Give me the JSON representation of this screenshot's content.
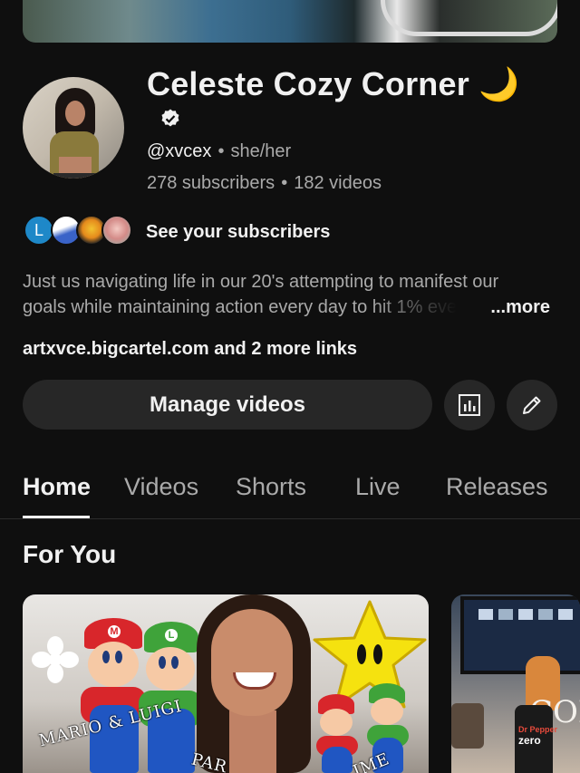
{
  "channel": {
    "name": "Celeste Cozy Corner",
    "name_emoji": "🌙",
    "handle": "@xvcex",
    "pronouns": "she/her",
    "subscribers": "278 subscribers",
    "videos": "182 videos",
    "separator": "•"
  },
  "subscribers_row": {
    "first_avatar_letter": "L",
    "label": "See your subscribers"
  },
  "description": {
    "line1": "Just us navigating life in our 20's attempting to manifest our",
    "line2": "goals while maintaining action every day to hit 1% eve",
    "more": "...more"
  },
  "links": {
    "url": "artxvce.bigcartel.com",
    "more": "and 2 more links"
  },
  "actions": {
    "manage": "Manage videos"
  },
  "tabs": [
    {
      "label": "Home",
      "active": true
    },
    {
      "label": "Videos",
      "active": false
    },
    {
      "label": "Shorts",
      "active": false
    },
    {
      "label": "Live",
      "active": false
    },
    {
      "label": "Releases",
      "active": false
    }
  ],
  "section": {
    "title": "For You"
  },
  "cards": {
    "one": {
      "overlay1": "MARIO & LUIGI",
      "overlay2": "PAR",
      "overlay3": "IME",
      "mario_cap_letter": "M",
      "luigi_cap_letter": "L"
    },
    "two": {
      "overlay": "COFF",
      "can_label": "Dr Pepper",
      "can_sub": "zero"
    }
  },
  "colors": {
    "background": "#0f0f0f",
    "surface": "#272727",
    "text_primary": "#f1f1f1",
    "text_secondary": "#aaaaaa"
  }
}
